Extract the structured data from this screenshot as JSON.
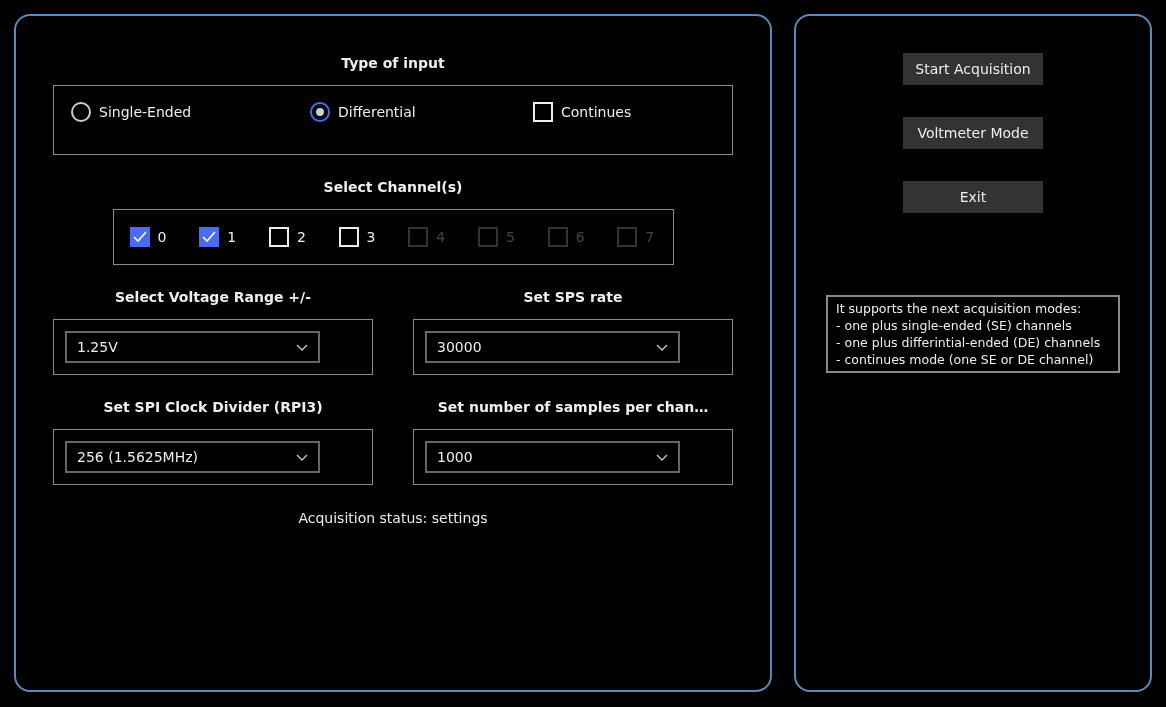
{
  "settings_panel": {
    "type_of_input": {
      "title": "Type of input",
      "options": [
        {
          "kind": "radio",
          "label": "Single-Ended",
          "selected": false
        },
        {
          "kind": "radio",
          "label": "Differential",
          "selected": true
        },
        {
          "kind": "checkbox",
          "label": "Continues",
          "checked": false
        }
      ]
    },
    "channels": {
      "title": "Select Channel(s)",
      "items": [
        {
          "label": "0",
          "checked": true,
          "disabled": false
        },
        {
          "label": "1",
          "checked": true,
          "disabled": false
        },
        {
          "label": "2",
          "checked": false,
          "disabled": false
        },
        {
          "label": "3",
          "checked": false,
          "disabled": false
        },
        {
          "label": "4",
          "checked": false,
          "disabled": true
        },
        {
          "label": "5",
          "checked": false,
          "disabled": true
        },
        {
          "label": "6",
          "checked": false,
          "disabled": true
        },
        {
          "label": "7",
          "checked": false,
          "disabled": true
        }
      ]
    },
    "dropdowns": [
      {
        "title": "Select Voltage Range +/-",
        "value": "1.25V"
      },
      {
        "title": "Set SPS rate",
        "value": "30000"
      },
      {
        "title": "Set SPI Clock Divider (RPI3)",
        "value": "256 (1.5625MHz)"
      },
      {
        "title": "Set number of samples per chan…",
        "value": "1000"
      }
    ],
    "status": "Acquisition status: settings"
  },
  "control_panel": {
    "buttons": [
      "Start Acquisition",
      "Voltmeter Mode",
      "Exit"
    ],
    "info": "It supports the next acquisition modes:\n- one plus single-ended (SE) channels\n- one plus differintial-ended (DE) channels\n- continues mode (one SE or DE channel)"
  }
}
